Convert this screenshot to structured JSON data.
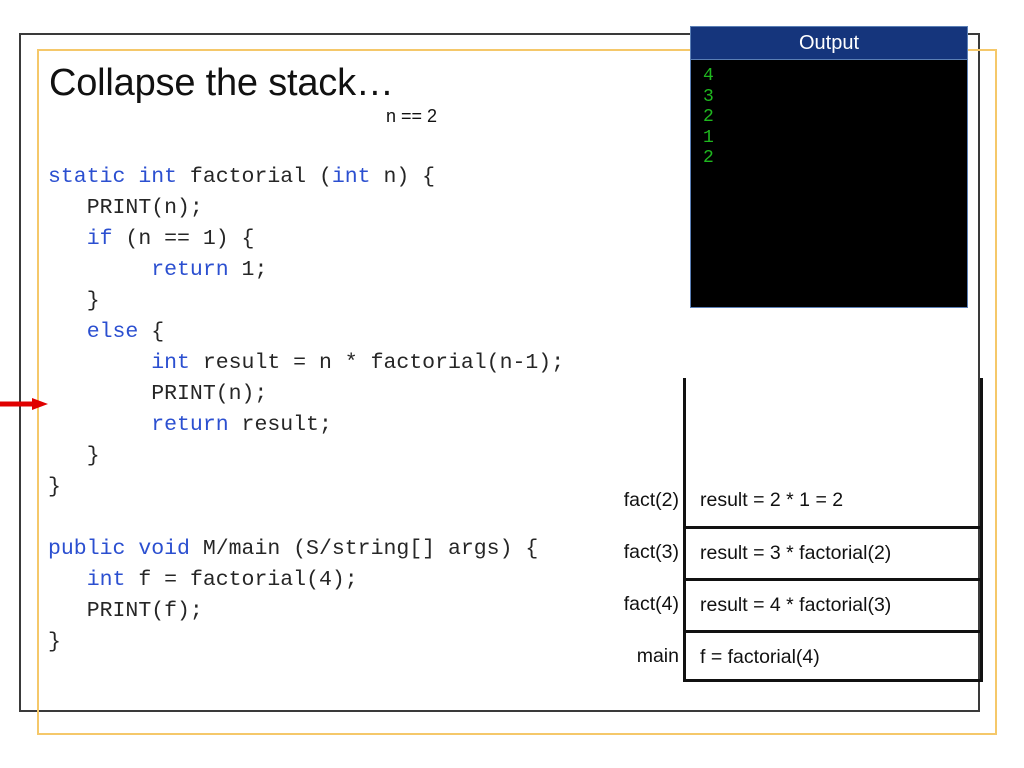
{
  "slide": {
    "title": "Collapse the stack…",
    "annotation": "n == 2",
    "border_color": "#3a3a3a",
    "accent_color": "#f5c86a"
  },
  "code": {
    "language": "java-like-pseudocode",
    "keyword_color": "#2b4fd0",
    "text_color": "#262626",
    "lines": [
      {
        "id": "l1",
        "segments": [
          {
            "t": "static int",
            "kw": true
          },
          {
            "t": " factorial (",
            "kw": false
          },
          {
            "t": "int",
            "kw": true
          },
          {
            "t": " n) {",
            "kw": false
          }
        ]
      },
      {
        "id": "l2",
        "segments": [
          {
            "t": "   PRINT(n);",
            "kw": false
          }
        ]
      },
      {
        "id": "l3",
        "segments": [
          {
            "t": "   ",
            "kw": false
          },
          {
            "t": "if",
            "kw": true
          },
          {
            "t": " (n == 1) {",
            "kw": false
          }
        ]
      },
      {
        "id": "l4",
        "segments": [
          {
            "t": "        ",
            "kw": false
          },
          {
            "t": "return",
            "kw": true
          },
          {
            "t": " 1;",
            "kw": false
          }
        ]
      },
      {
        "id": "l5",
        "segments": [
          {
            "t": "   }",
            "kw": false
          }
        ]
      },
      {
        "id": "l6",
        "segments": [
          {
            "t": "   ",
            "kw": false
          },
          {
            "t": "else",
            "kw": true
          },
          {
            "t": " {",
            "kw": false
          }
        ]
      },
      {
        "id": "l7",
        "segments": [
          {
            "t": "        ",
            "kw": false
          },
          {
            "t": "int",
            "kw": true
          },
          {
            "t": " result = n * factorial(n-1);",
            "kw": false
          }
        ]
      },
      {
        "id": "l8",
        "segments": [
          {
            "t": "        PRINT(n);",
            "kw": false
          }
        ]
      },
      {
        "id": "l9",
        "segments": [
          {
            "t": "        ",
            "kw": false
          },
          {
            "t": "return",
            "kw": true
          },
          {
            "t": " result;",
            "kw": false
          }
        ]
      },
      {
        "id": "l10",
        "segments": [
          {
            "t": "   }",
            "kw": false
          }
        ]
      },
      {
        "id": "l11",
        "segments": [
          {
            "t": "}",
            "kw": false
          }
        ]
      },
      {
        "id": "l12",
        "blank": true
      },
      {
        "id": "l13",
        "segments": [
          {
            "t": "public void",
            "kw": true
          },
          {
            "t": " M/main (S/string[] args) {",
            "kw": false
          }
        ]
      },
      {
        "id": "l14",
        "segments": [
          {
            "t": "   ",
            "kw": false
          },
          {
            "t": "int",
            "kw": true
          },
          {
            "t": " f = factorial(4);",
            "kw": false
          }
        ]
      },
      {
        "id": "l15",
        "segments": [
          {
            "t": "   PRINT(f);",
            "kw": false
          }
        ]
      },
      {
        "id": "l16",
        "segments": [
          {
            "t": "}",
            "kw": false
          }
        ]
      }
    ]
  },
  "output_panel": {
    "title": "Output",
    "title_bg": "#15357c",
    "body_bg": "#000000",
    "text_color": "#1fb81f",
    "lines": [
      "4",
      "3",
      "2",
      "1",
      "2"
    ]
  },
  "call_stack": {
    "frames": [
      {
        "tag": "",
        "body": "",
        "topline": false
      },
      {
        "tag": "fact(2)",
        "body": "result = 2 * 1 = 2",
        "topline": false
      },
      {
        "tag": "fact(3)",
        "body": "result = 3 * factorial(2)",
        "topline": true
      },
      {
        "tag": "fact(4)",
        "body": "result = 4 * factorial(3)",
        "topline": true
      },
      {
        "tag": "main",
        "body": "f = factorial(4)",
        "topline": true
      }
    ]
  },
  "pointer": {
    "label": "execution-pointer",
    "color": "#e00000",
    "points_to_line": "PRINT(n);"
  }
}
